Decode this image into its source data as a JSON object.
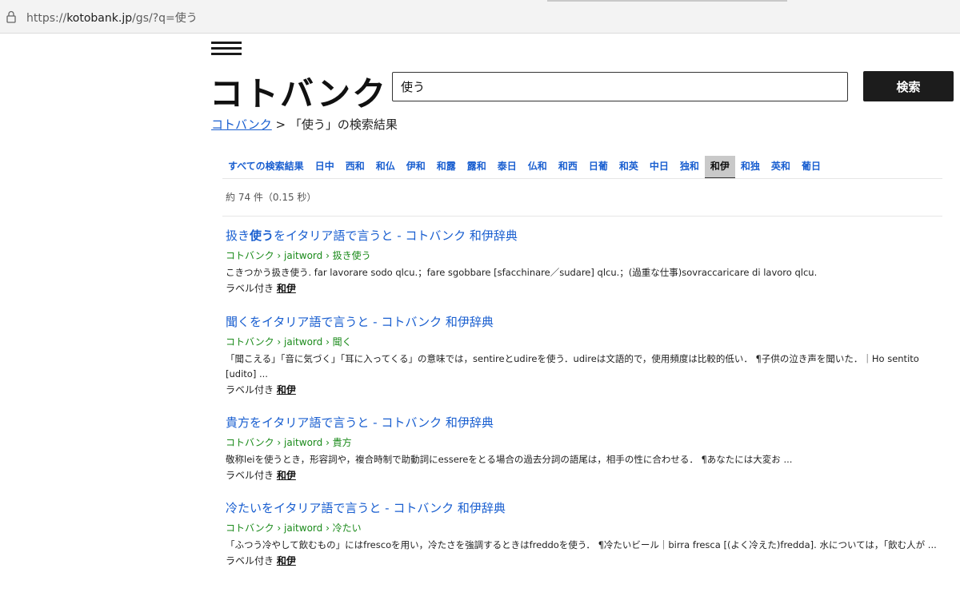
{
  "browser": {
    "url_prefix": "https://",
    "url_host": "kotobank.jp",
    "url_path": "/gs/?q=使う"
  },
  "header": {
    "logo": "コトバンク",
    "search_value": "使う",
    "search_button": "検索"
  },
  "breadcrumb": {
    "home": "コトバンク",
    "separator": ">",
    "current": "「使う」の検索結果"
  },
  "tabs": [
    {
      "label": "すべての検索結果"
    },
    {
      "label": "日中"
    },
    {
      "label": "西和"
    },
    {
      "label": "和仏"
    },
    {
      "label": "伊和"
    },
    {
      "label": "和露"
    },
    {
      "label": "露和"
    },
    {
      "label": "泰日"
    },
    {
      "label": "仏和"
    },
    {
      "label": "和西"
    },
    {
      "label": "日葡"
    },
    {
      "label": "和英"
    },
    {
      "label": "中日"
    },
    {
      "label": "独和"
    },
    {
      "label": "和伊",
      "active": true
    },
    {
      "label": "和独"
    },
    {
      "label": "英和"
    },
    {
      "label": "葡日"
    }
  ],
  "result_count": "約 74 件（0.15 秒）",
  "results": [
    {
      "title_pre": "扱き",
      "title_bold": "使う",
      "title_post": "をイタリア語で言うと - コトバンク 和伊辞典",
      "path": "コトバンク › jaitword › 扱き使う",
      "snippet": "こきつかう扱き使う. far lavorare sodo qlcu.；fare sgobbare [sfacchinare／sudare] qlcu.；(過重な仕事)sovraccaricare di lavoro qlcu.",
      "label_prefix": "ラベル付き",
      "label_link": "和伊"
    },
    {
      "title_pre": "聞くをイタリア語で言うと - コトバンク 和伊辞典",
      "title_bold": "",
      "title_post": "",
      "path": "コトバンク › jaitword › 聞く",
      "snippet": "「聞こえる」「音に気づく」「耳に入ってくる」の意味では，sentireとudireを使う．udireは文語的で，使用頻度は比較的低い． ¶子供の泣き声を聞いた．｜Ho sentito [udito] ...",
      "label_prefix": "ラベル付き",
      "label_link": "和伊"
    },
    {
      "title_pre": "貴方をイタリア語で言うと - コトバンク 和伊辞典",
      "title_bold": "",
      "title_post": "",
      "path": "コトバンク › jaitword › 貴方",
      "snippet": "敬称leiを使うとき，形容詞や，複合時制で助動詞にessereをとる場合の過去分詞の語尾は，相手の性に合わせる． ¶あなたには大変お ...",
      "label_prefix": "ラベル付き",
      "label_link": "和伊"
    },
    {
      "title_pre": "冷たいをイタリア語で言うと - コトバンク 和伊辞典",
      "title_bold": "",
      "title_post": "",
      "path": "コトバンク › jaitword › 冷たい",
      "snippet": "「ふつう冷やして飲むもの」にはfrescoを用い，冷たさを強調するときはfreddoを使う． ¶冷たいビール｜birra fresca [(よく冷えた)fredda]. 水については，「飲む人が ...",
      "label_prefix": "ラベル付き",
      "label_link": "和伊"
    }
  ]
}
